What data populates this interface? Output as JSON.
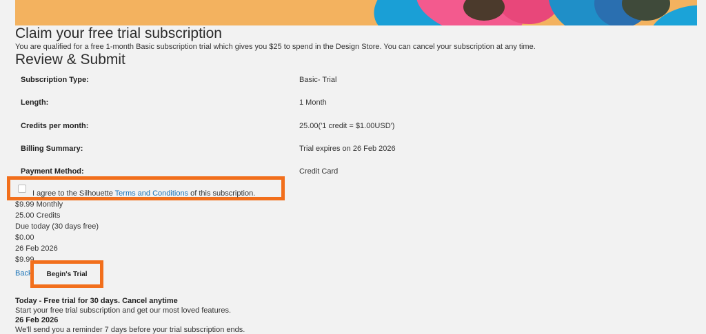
{
  "header": {
    "title": "Claim your free trial subscription",
    "intro": "You are qualified for a free 1-month Basic subscription trial which gives you $25 to spend in the Design Store. You can cancel your subscription at any time.",
    "review_title": "Review & Submit"
  },
  "details": [
    {
      "label": "Subscription Type:",
      "value": "Basic- Trial"
    },
    {
      "label": "Length:",
      "value": "1 Month"
    },
    {
      "label": "Credits per month:",
      "value": "25.00('1 credit = $1.00USD')"
    },
    {
      "label": "Billing Summary:",
      "value": "Trial expires on 26 Feb 2026"
    },
    {
      "label": "Payment Method:",
      "value": "Credit Card"
    }
  ],
  "agreement": {
    "prefix": "I agree to the Silhouette ",
    "link": "Terms and Conditions",
    "suffix": " of this subscription."
  },
  "summary": [
    "$9.99 Monthly",
    "25.00 Credits",
    "Due today (30 days free)",
    "$0.00",
    "26 Feb 2026",
    "$9.99"
  ],
  "actions": {
    "back": "Back",
    "begin": "Begin's Trial"
  },
  "timeline": {
    "today_title": "Today - Free trial for 30 days. Cancel anytime",
    "today_text": "Start your free trial subscription and get our most loved features.",
    "date_title": "26 Feb 2026",
    "date_text": "We'll send you a reminder 7 days before your trial subscription ends."
  },
  "colors": {
    "highlight": "#f26f1c",
    "link": "#1a73b8"
  }
}
